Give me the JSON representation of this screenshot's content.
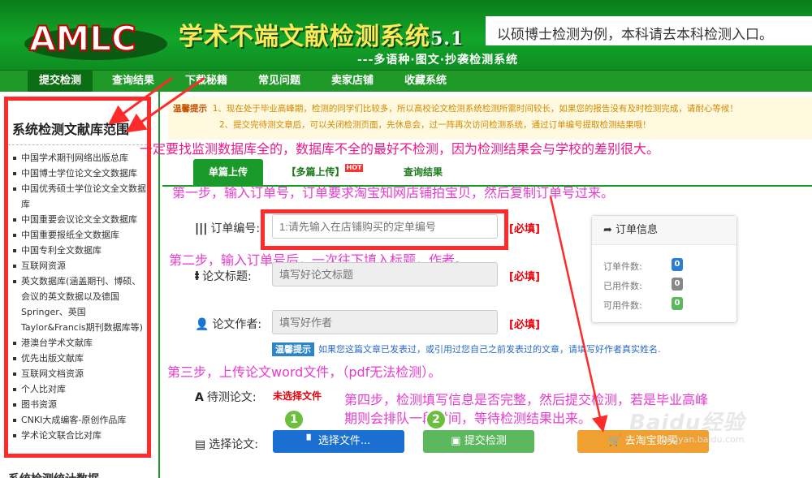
{
  "header": {
    "system_title": "学术不端文献检测系统",
    "version": "5.1",
    "subtitle": "---多语种·图文·抄袭检测系统",
    "top_hint": "以硕博士检测为例，本科请去本科检测入口。"
  },
  "nav": [
    "提交检测",
    "查询结果",
    "下载秘籍",
    "常见问题",
    "卖家店铺",
    "收藏系统"
  ],
  "sidebar": {
    "title": "系统检测文献库范围",
    "items": [
      "中国学术期刊网络出版总库",
      "中国博士学位论文全文数据库",
      "中国优秀硕士学位论文全文数据库",
      "中国重要会议论文全文数据库",
      "中国重要报纸全文数据库",
      "中国专利全文数据库",
      "互联网资源",
      "英文数据库(涵盖期刊、博硕、会议的英文数据以及德国Springer、英国Taylor&Francis期刊数据库等)",
      "港澳台学术文献库",
      "优先出版文献库",
      "互联网文档资源",
      "个人比对库",
      "图书资源",
      "CNKI大成编客-原创作品库",
      "学术论文联合比对库"
    ],
    "bottom_heading": "系统检测统计数据"
  },
  "notice": {
    "label": "温馨提示",
    "line1": "1、现在处于毕业高峰期，检测的同学们比较多，所以高校论文检测系统检测所需时间较长，如果您的报告没有及时检测完成，请耐心等候！",
    "line2": "2、提交完待测文章后，可以关闭检测页面，先休息会，过一阵再次访问检测系统，通过订单编号提取检测结果哦！"
  },
  "annotations": {
    "warn": "一定要找监测数据库全的，数据库不全的最好不检测，因为检测结果会与学校的差别很大。",
    "step1": "第一步，输入订单号，订单要求淘宝知网店铺拍宝贝，然后复制订单号过来。",
    "step2": "第二步，输入订单号后，一次往下填入标题，作者。",
    "step3": "第三步，上传论文word文件，（pdf无法检测）。",
    "step4_line1": "第四步，检测填写信息是否完整，然后提交检测，若是毕业高峰",
    "step4_line2": "期则会排队一段时间，等待检测结果出来。"
  },
  "tabs": {
    "single": "单篇上传",
    "multi": "【多篇上传】",
    "hot": "HOT",
    "query": "查询结果"
  },
  "form": {
    "order_label": "订单编号:",
    "order_placeholder": "1:请先输入在店铺购买的定单编号",
    "title_label": "论文标题:",
    "title_placeholder": "填写好论文标题",
    "author_label": "论文作者:",
    "author_placeholder": "填写好作者",
    "required": "[必填]",
    "tip_tag": "温馨提示",
    "tip_text": "如果您这篇文章已发表过，或引用过您自己之前发表过的文章，请填写好作者真实姓名.",
    "pending_label": "待测论文:",
    "no_file": "未选择文件",
    "select_label": "选择论文:"
  },
  "info_panel": {
    "title": "订单信息",
    "rows": [
      {
        "label": "订单件数:",
        "value": "0",
        "color": "#2a7fd4"
      },
      {
        "label": "已用件数:",
        "value": "0",
        "color": "#888888"
      },
      {
        "label": "可用件数:",
        "value": "0",
        "color": "#5cb85c"
      }
    ]
  },
  "buttons": {
    "choose": "选择文件...",
    "submit": "提交检测",
    "buy": "去淘宝购买"
  },
  "step_circles": [
    "1",
    "2"
  ],
  "watermark": {
    "text": "Baidu经验",
    "url": "jingyan.baidu.com"
  },
  "colors": {
    "brand_green": "#1a9a2a",
    "annotation_red": "#ff2a2a",
    "annotation_pink": "#e8198b"
  }
}
